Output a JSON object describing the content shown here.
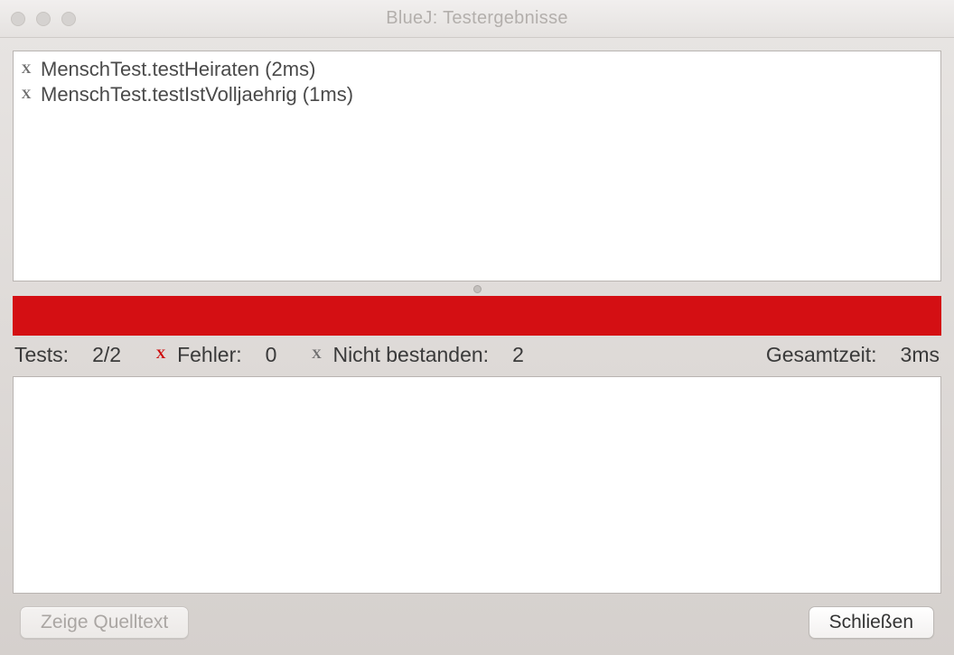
{
  "window": {
    "title": "BlueJ:  Testergebnisse"
  },
  "tests": [
    {
      "icon": "x-icon",
      "label": "MenschTest.testHeiraten (2ms)"
    },
    {
      "icon": "x-icon",
      "label": "MenschTest.testIstVolljaehrig (1ms)"
    }
  ],
  "statusColor": "#d40f13",
  "summary": {
    "tests_label": "Tests:",
    "tests_value": "2/2",
    "errors_label": "Fehler:",
    "errors_value": "0",
    "failed_label": "Nicht bestanden:",
    "failed_value": "2",
    "total_label": "Gesamtzeit:",
    "total_value": "3ms"
  },
  "buttons": {
    "show_source": "Zeige Quelltext",
    "close": "Schließen"
  }
}
